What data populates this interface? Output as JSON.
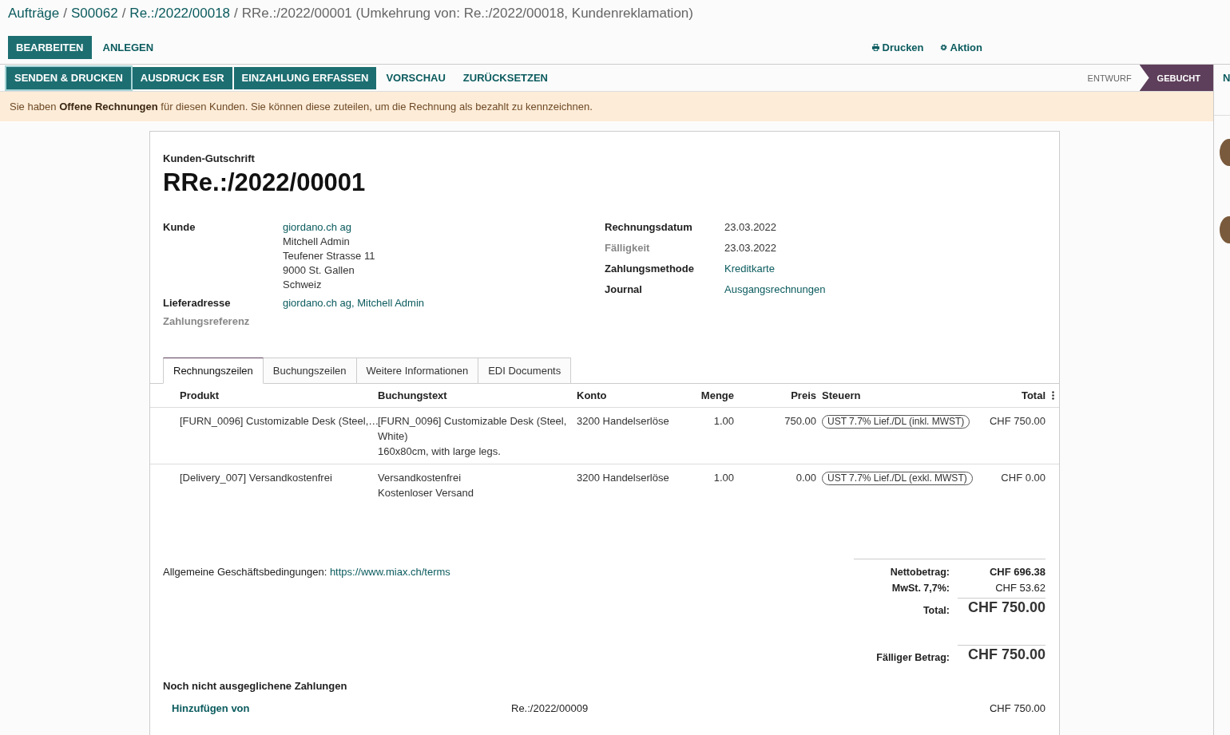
{
  "breadcrumbs": [
    {
      "label": "Aufträge",
      "link": true
    },
    {
      "separator": "/",
      "label": "S00062",
      "link": true
    },
    {
      "separator": "/",
      "label": "Re.:/2022/00018",
      "link": true
    },
    {
      "separator": "/",
      "label": "RRe.:/2022/00001 (Umkehrung von: Re.:/2022/00018, Kundenreklamation)",
      "link": false
    }
  ],
  "control_buttons": [
    {
      "label": "BEARBEITEN",
      "primary": true
    },
    {
      "label": "ANLEGEN",
      "primary": false
    }
  ],
  "menus": [
    {
      "label": "Drucken",
      "kind": "print"
    },
    {
      "label": "Aktion",
      "kind": "gear"
    }
  ],
  "action_buttons": [
    {
      "label": "SENDEN & DRUCKEN",
      "primary": true
    },
    {
      "label": "AUSDRUCK ESR",
      "primary": true
    },
    {
      "label": "EINZAHLUNG ERFASSEN",
      "primary": true
    },
    {
      "label": "VORSCHAU",
      "primary": false
    },
    {
      "label": "ZURÜCKSETZEN",
      "primary": false
    }
  ],
  "status_steps": [
    {
      "label": "ENTWURF",
      "selected": false
    },
    {
      "label": "GEBUCHT",
      "selected": true
    }
  ],
  "alert": "Sie haben **Offene Rechnungen** für diesen Kunden. Sie können diese zuteilen, um die Rechnung als bezahlt zu kennzeichnen.",
  "chatter": {
    "header": "N",
    "avatars": [
      {
        "kind": "avatar"
      },
      {
        "kind": "avatar"
      }
    ]
  },
  "document": {
    "type": "Kunden-Gutschrift",
    "number": "RRe.:/2022/00001",
    "left_fields": [
      {
        "label": "Kunde",
        "muted": false,
        "values": [
          {
            "text": "giordano.ch ag",
            "link": true
          },
          {
            "text": "Mitchell Admin",
            "link": false
          },
          {
            "text": "Teufener Strasse 11",
            "link": false
          },
          {
            "text": "9000 St. Gallen",
            "link": false
          },
          {
            "text": "Schweiz",
            "link": false
          }
        ]
      },
      {
        "label": "Lieferadresse",
        "muted": false,
        "values": [
          {
            "text": "giordano.ch ag, Mitchell Admin",
            "link": true
          }
        ]
      },
      {
        "label": "Zahlungsreferenz",
        "muted": true
      }
    ],
    "right_fields": [
      {
        "label": "Rechnungsdatum",
        "muted": false,
        "values": [
          {
            "text": "23.03.2022",
            "link": false
          }
        ]
      },
      {
        "label": "Fälligkeit",
        "muted": true,
        "values": [
          {
            "text": "23.03.2022",
            "link": false
          }
        ]
      },
      {
        "label": "Zahlungsmethode",
        "muted": false,
        "values": [
          {
            "text": "Kreditkarte",
            "link": true
          }
        ]
      },
      {
        "label": "Journal",
        "muted": false,
        "values": [
          {
            "text": "Ausgangsrechnungen",
            "link": true
          }
        ]
      }
    ],
    "tabs": [
      {
        "label": "Rechnungszeilen",
        "selected": true
      },
      {
        "label": "Buchungszeilen",
        "selected": false
      },
      {
        "label": "Weitere Informationen",
        "selected": false
      },
      {
        "label": "EDI Documents",
        "selected": false
      }
    ],
    "table": {
      "columns": [
        "Produkt",
        "Buchungstext",
        "Konto",
        "Menge",
        "Preis",
        "Steuern",
        "Total"
      ],
      "rows": [
        {
          "product": "[FURN_0096] Customizable Desk (Steel,…",
          "description": [
            "[FURN_0096] Customizable Desk (Steel, White)",
            "160x80cm, with large legs."
          ],
          "account": "3200 Handelserlöse",
          "quantity": "1.00",
          "price": "750.00",
          "tax": "UST 7.7% Lief./DL (inkl. MWST)",
          "total": "CHF 750.00"
        },
        {
          "product": "[Delivery_007] Versandkostenfrei",
          "description": [
            "Versandkostenfrei",
            "Kostenloser Versand"
          ],
          "account": "3200 Handelserlöse",
          "quantity": "1.00",
          "price": "0.00",
          "tax": "UST 7.7% Lief./DL (exkl. MWST)",
          "total": "CHF 0.00"
        }
      ]
    },
    "terms": {
      "label": "Allgemeine Geschäftsbedingungen:",
      "link": "https://www.miax.ch/terms"
    },
    "totals": [
      {
        "label": "Nettobetrag:",
        "value": "CHF 696.38",
        "kind": "bold"
      },
      {
        "label": "MwSt. 7,7%:",
        "value": "CHF 53.62",
        "kind": "normal"
      },
      {
        "label": "Total:",
        "value": "CHF 750.00",
        "kind": "large"
      }
    ],
    "amount_due": {
      "label": "Fälliger Betrag:",
      "value": "CHF 750.00"
    },
    "outstanding": {
      "title": "Noch nicht ausgeglichene Zahlungen",
      "rows": [
        {
          "action": "Hinzufügen von",
          "reference": "Re.:/2022/00009",
          "amount": "CHF 750.00"
        }
      ]
    }
  }
}
